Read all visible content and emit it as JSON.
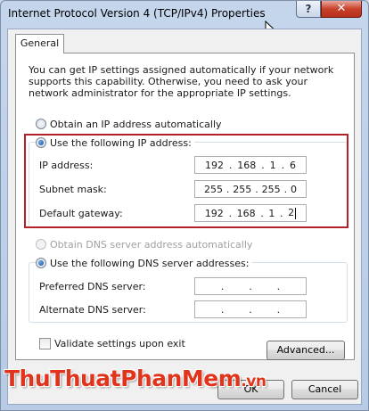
{
  "window": {
    "title": "Internet Protocol Version 4 (TCP/IPv4) Properties",
    "help_glyph": "?",
    "close_glyph": "✕"
  },
  "tabs": [
    {
      "label": "General"
    }
  ],
  "description": "You can get IP settings assigned automatically if your network supports this capability. Otherwise, you need to ask your network administrator for the appropriate IP settings.",
  "ip_mode": {
    "auto_label": "Obtain an IP address automatically",
    "manual_label": "Use the following IP address:",
    "selected": "manual"
  },
  "ip_fields": {
    "ip_address": {
      "label": "IP address:",
      "octets": [
        "192",
        "168",
        "1",
        "6"
      ]
    },
    "subnet_mask": {
      "label": "Subnet mask:",
      "octets": [
        "255",
        "255",
        "255",
        "0"
      ]
    },
    "default_gateway": {
      "label": "Default gateway:",
      "octets": [
        "192",
        "168",
        "1",
        "2"
      ]
    }
  },
  "dns_mode": {
    "auto_label": "Obtain DNS server address automatically",
    "manual_label": "Use the following DNS server addresses:",
    "selected": "manual"
  },
  "dns_fields": {
    "preferred": {
      "label": "Preferred DNS server:",
      "octets": [
        "",
        "",
        "",
        ""
      ]
    },
    "alternate": {
      "label": "Alternate DNS server:",
      "octets": [
        "",
        "",
        "",
        ""
      ]
    }
  },
  "validate": {
    "label": "Validate settings upon exit",
    "checked": false
  },
  "buttons": {
    "advanced": "Advanced...",
    "ok": "OK",
    "cancel": "Cancel"
  },
  "dot": ".",
  "watermark": {
    "main": "ThuThuatPhanMem",
    "suffix": ".vn"
  },
  "colors": {
    "highlight_border": "#b3212a",
    "watermark": "#e0341c"
  }
}
